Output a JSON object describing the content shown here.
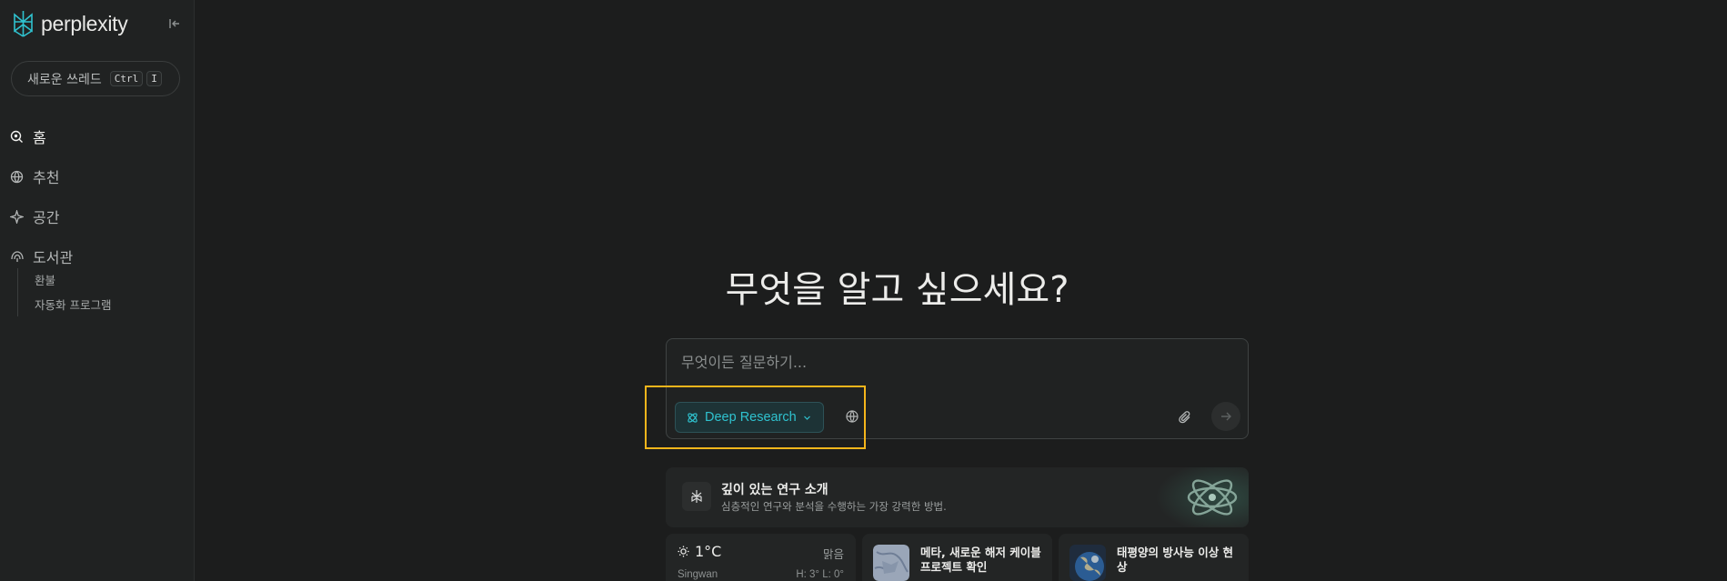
{
  "sidebar": {
    "logo_text": "perplexity",
    "new_thread": {
      "label": "새로운 쓰레드",
      "keys": [
        "Ctrl",
        "I"
      ]
    },
    "nav": [
      {
        "label": "홈",
        "icon": "search-icon",
        "active": true
      },
      {
        "label": "추천",
        "icon": "globe-icon"
      },
      {
        "label": "공간",
        "icon": "sparkle-icon"
      },
      {
        "label": "도서관",
        "icon": "library-icon"
      }
    ],
    "library_items": [
      "환불",
      "자동화 프로그램"
    ]
  },
  "main": {
    "headline": "무엇을 알고 싶으세요?",
    "ask": {
      "placeholder": "무엇이든 질문하기...",
      "mode_label": "Deep Research"
    },
    "intro_card": {
      "title": "깊이 있는 연구 소개",
      "subtitle": "심층적인 연구와 분석을 수행하는 가장 강력한 방법."
    },
    "weather": {
      "temperature": "1°C",
      "condition": "맑음",
      "location": "Singwan",
      "high_low": "H: 3° L: 0°"
    },
    "news": [
      {
        "title": "메타, 새로운 해저 케이블 프로젝트 확인"
      },
      {
        "title": "태평양의 방사능 이상 현상"
      }
    ]
  },
  "colors": {
    "accent": "#2fc2cf",
    "highlight": "#f5b51b",
    "background": "#1c1d1d",
    "sidebar": "#202222"
  }
}
